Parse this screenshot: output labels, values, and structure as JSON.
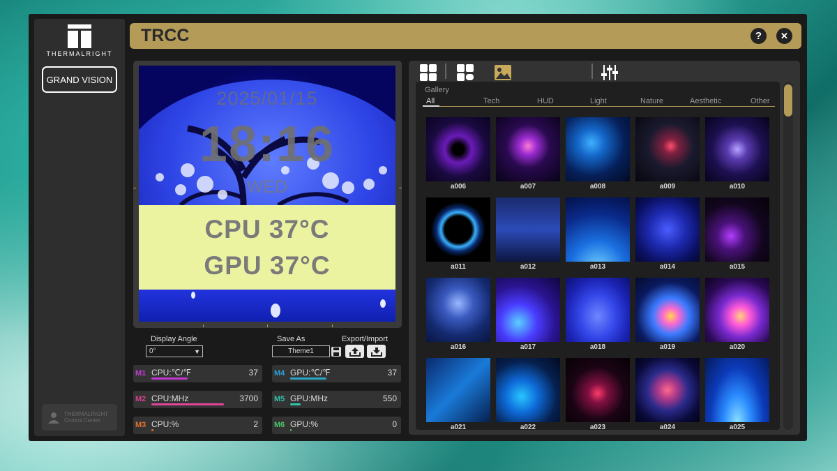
{
  "app": {
    "title": "TRCC",
    "brand": "THERMALRIGHT",
    "device": "GRAND VISION",
    "control_center": [
      "THERMALRIGHT",
      "Control Center"
    ],
    "help_glyph": "?",
    "close_glyph": "✕"
  },
  "preview": {
    "date": "2025/01/15",
    "time": "18:16",
    "day": "WED",
    "cpu_line": "CPU  37°C",
    "gpu_line": "GPU  37°C"
  },
  "controls": {
    "display_angle_label": "Display Angle",
    "display_angle_value": "0°",
    "save_as_label": "Save As",
    "save_as_value": "Theme1",
    "export_import_label": "Export/Import"
  },
  "sensors": [
    {
      "slot": "M1",
      "name": "CPU:℃/℉",
      "value": "37",
      "slot_color": "#c23bd4",
      "bar_color": "#c23bd4",
      "fill": 0.37
    },
    {
      "slot": "M2",
      "name": "CPU:MHz",
      "value": "3700",
      "slot_color": "#d6408e",
      "bar_color": "#e0459a",
      "fill": 0.74
    },
    {
      "slot": "M3",
      "name": "CPU:%",
      "value": "2",
      "slot_color": "#e0712e",
      "bar_color": "#e0712e",
      "fill": 0.02
    },
    {
      "slot": "M4",
      "name": "GPU:℃/℉",
      "value": "37",
      "slot_color": "#2aa0d8",
      "bar_color": "#2aa8c8",
      "fill": 0.37
    },
    {
      "slot": "M5",
      "name": "GPU:MHz",
      "value": "550",
      "slot_color": "#2ec4a8",
      "bar_color": "#2ec4a8",
      "fill": 0.11
    },
    {
      "slot": "M6",
      "name": "GPU:%",
      "value": "0",
      "slot_color": "#4cc46a",
      "bar_color": "#4cc46a",
      "fill": 0.0
    }
  ],
  "gallery": {
    "label": "Gallery",
    "categories": [
      "All",
      "Tech",
      "HUD",
      "Light",
      "Nature",
      "Aesthetic",
      "Other"
    ],
    "items": [
      {
        "id": "a006",
        "bg": "radial-gradient(circle at 50% 50%, #000 0%, #000 12%, #6a1bb8 30%, #1a0a40 60%, #0b0320 100%)"
      },
      {
        "id": "a007",
        "bg": "radial-gradient(circle at 50% 45%, #ff7ad6 0%, #9b2cd1 18%, #2a0a50 45%, #070215 100%)"
      },
      {
        "id": "a008",
        "bg": "radial-gradient(circle at 40% 40%, #3fb0ff 0%, #1466c8 25%, #06205a 60%, #020a22 100%)"
      },
      {
        "id": "a009",
        "bg": "radial-gradient(circle at 55% 45%, #ff4d6d 0%, #802040 15%, #1a1a2e 45%, #06060e 100%)"
      },
      {
        "id": "a010",
        "bg": "radial-gradient(circle at 50% 50%, #b7a4ff 0%, #5a3bb0 22%, #1d1050 55%, #06031a 100%)"
      },
      {
        "id": "a011",
        "bg": "radial-gradient(circle at 50% 50%, #000 0%, #000 30%, #3ab0ff 38%, #0a2a6e 48%, #000 60%)"
      },
      {
        "id": "a012",
        "bg": "linear-gradient(180deg, #1a2a6e 0%, #2c4bb8 50%, #0c1640 100%)"
      },
      {
        "id": "a013",
        "bg": "radial-gradient(circle at 50% 110%, #6fd0ff 0%, #1a6fe0 35%, #0a2a8a 70%, #04104a 100%)"
      },
      {
        "id": "a014",
        "bg": "radial-gradient(circle at 50% 50%, #4a5cff 0%, #1e2ab0 40%, #0a1060 75%, #050830 100%)"
      },
      {
        "id": "a015",
        "bg": "radial-gradient(circle at 40% 60%, #b23cff 0%, #4a127a 25%, #12061e 60%, #050208 100%)"
      },
      {
        "id": "a016",
        "bg": "radial-gradient(circle at 50% 40%, #9ab8ff 0%, #3a5ac0 30%, #142a70 65%, #0a1640 100%)"
      },
      {
        "id": "a017",
        "bg": "radial-gradient(circle at 35% 70%, #5ad0ff 0%, #4a3cff 30%, #2a1490 60%, #10063e 100%)"
      },
      {
        "id": "a018",
        "bg": "radial-gradient(ellipse at 50% 60%, #6f86ff 0%, #3346e8 40%, #1a22b0 70%, #0c1070 100%)"
      },
      {
        "id": "a019",
        "bg": "radial-gradient(circle at 55% 60%, #ffd84a 0%, #ff6ad0 15%, #3a7aff 35%, #0b1a60 65%, #050a2a 100%)"
      },
      {
        "id": "a020",
        "bg": "radial-gradient(circle at 55% 60%, #ffd27a 0%, #ff5ad8 18%, #7a2ad0 40%, #2a0a55 70%, #0e031e 100%)"
      },
      {
        "id": "a021",
        "bg": "linear-gradient(135deg, #0a2a6e 0%, #1a7ad8 50%, #062050 100%)"
      },
      {
        "id": "a022",
        "bg": "radial-gradient(circle at 40% 60%, #29c6ff 0%, #0e6ad8 30%, #06204e 65%, #020a1e 100%)"
      },
      {
        "id": "a023",
        "bg": "radial-gradient(circle at 50% 55%, #ff3a6a 0%, #801040 20%, #1a0414 55%, #060104 100%)"
      },
      {
        "id": "a024",
        "bg": "radial-gradient(circle at 50% 50%, #ff6a8a 0%, #b03a8a 20%, #2a2a8a 45%, #0a0a3a 75%, #03031a 100%)"
      },
      {
        "id": "a025",
        "bg": "radial-gradient(ellipse at 50% 100%, #8ae0ff 0%, #2a8aff 30%, #0c3ab8 60%, #051a5a 100%)"
      }
    ]
  },
  "colors": {
    "accent": "#b59b58",
    "panel": "#333333",
    "window": "#1a1a1a"
  }
}
